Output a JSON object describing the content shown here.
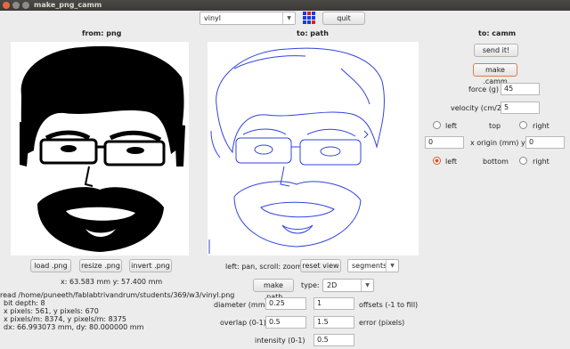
{
  "window": {
    "title": "make_png_camm"
  },
  "toolbar": {
    "process_value": "vinyl",
    "quit_label": "quit"
  },
  "left": {
    "header": "from: png",
    "load_label": "load .png",
    "resize_label": "resize .png",
    "invert_label": "invert .png",
    "coords": "x: 63.583 mm  y: 57.400 mm",
    "info": [
      "read /home/puneeth/fablabtrivandrum/students/369/w3/vinyl.png",
      "bit depth: 8",
      "x pixels: 561, y pixels: 670",
      "x pixels/m: 8374, y pixels/m: 8375",
      "dx: 66.993073 mm, dy: 80.000000 mm"
    ]
  },
  "middle": {
    "header": "to: path",
    "pan_hint": "left: pan, scroll: zoom",
    "reset_label": "reset view",
    "view_mode": "segments",
    "make_path_label": "make .path",
    "type_label": "type:",
    "type_value": "2D",
    "diameter_label": "diameter (mm)",
    "diameter_value": "0.25",
    "offsets_value": "1",
    "offsets_label": "offsets (-1 to fill)",
    "overlap_label": "overlap (0-1)",
    "overlap_value": "0.5",
    "error_value": "1.5",
    "error_label": "error (pixels)",
    "intensity_label": "intensity (0-1)",
    "intensity_value": "0.5"
  },
  "right": {
    "header": "to: camm",
    "send_label": "send it!",
    "make_camm_label": "make .camm",
    "force_label": "force (g)",
    "force_value": "45",
    "velocity_label": "velocity (cm/2)",
    "velocity_value": "5",
    "origin_top_left": "left",
    "origin_top": "top",
    "origin_top_right": "right",
    "origin_x_value": "0",
    "origin_label": "x  origin (mm)  y",
    "origin_y_value": "0",
    "origin_bottom_left": "left",
    "origin_bottom": "bottom",
    "origin_bottom_right": "right"
  },
  "colors": {
    "path_stroke": "#3344dd",
    "accent": "#d6542a"
  }
}
